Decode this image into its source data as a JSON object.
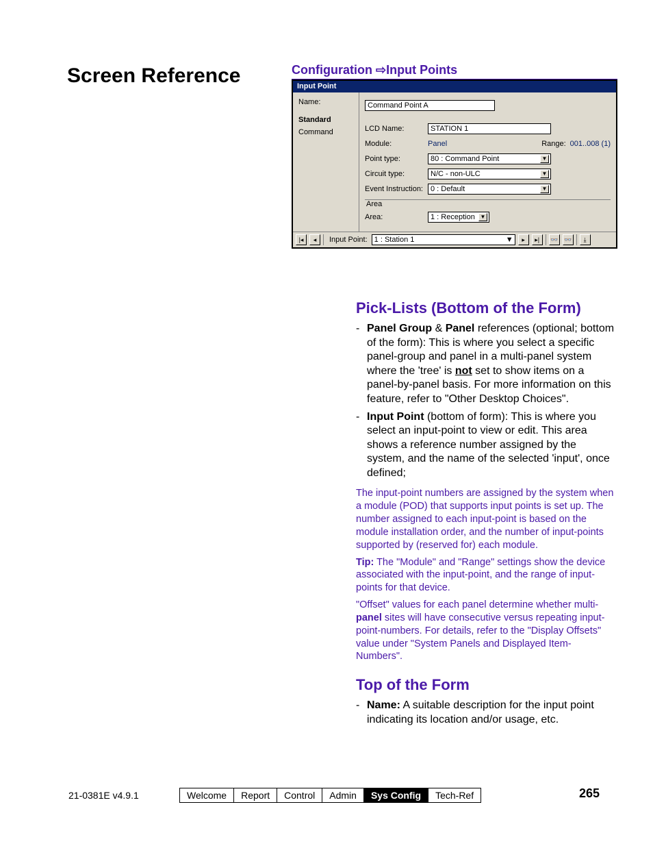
{
  "section_title": "Screen Reference",
  "breadcrumb": {
    "a": "Configuration",
    "sep": "⇨",
    "b": "Input Points"
  },
  "win": {
    "title": "Input Point",
    "left": {
      "name_label": "Name:",
      "tab_standard": "Standard",
      "tab_command": "Command"
    },
    "form": {
      "name_value": "Command Point A",
      "lcd_label": "LCD Name:",
      "lcd_value": "STATION 1",
      "module_label": "Module:",
      "module_value": "Panel",
      "range_label": "Range:",
      "range_value": "001..008 (1)",
      "point_type_label": "Point type:",
      "point_type_value": "80 : Command Point",
      "circuit_type_label": "Circuit type:",
      "circuit_type_value": "N/C - non-ULC",
      "event_instr_label": "Event Instruction:",
      "event_instr_value": "0 : Default",
      "area_group": "Area",
      "area_label": "Area:",
      "area_value": "1 : Reception"
    },
    "nav": {
      "first": "▏◂",
      "prev": "◂",
      "label": "Input Point:",
      "value": "1 : Station 1",
      "next": "▸",
      "last": "▸▏",
      "binoc1": "🔍",
      "binoc2": "🔎",
      "save": "💾"
    }
  },
  "sec_picklists": {
    "heading": "Pick-Lists (Bottom of the Form)",
    "b1_lead": "Panel Group",
    "b1_amp": " & ",
    "b1_lead2": "Panel",
    "b1_rest": " references (optional; bottom of the form): This is where you select a specific panel-group and panel in a multi-panel system where the 'tree' is ",
    "b1_not": "not",
    "b1_rest2": " set to show items on a panel-by-panel basis.  For more information on this feature, refer to \"Other Desktop Choices\".",
    "b2_lead": "Input Point",
    "b2_rest": " (bottom of form): This is where you select an input-point to view or edit.  This area shows a reference number assigned by the system, and the name of the selected 'input', once defined;",
    "note1": "The input-point numbers are assigned by the system when a module (POD) that supports input points is set up.  The number assigned to each input-point is based on the module installation order, and the number of input-points supported by (reserved for) each module.",
    "note2a": "Tip:",
    "note2b": "  The \"Module\" and \"Range\" settings show the device associated with the input-point, and the range of input-points for that device.",
    "note3a": "\"Offset\" values for each panel determine whether multi-",
    "note3b": "panel",
    "note3c": " sites will have consecutive versus repeating input-point-numbers.  For details, refer to the \"Display Offsets\" value under \"System Panels and Displayed Item-Numbers\"."
  },
  "sec_top": {
    "heading": "Top of the Form",
    "b1_lead": "Name:",
    "b1_rest": " A suitable description for the input point indicating its location and/or usage, etc."
  },
  "footer": {
    "doc": "21-0381E v4.9.1",
    "tabs": [
      "Welcome",
      "Report",
      "Control",
      "Admin",
      "Sys Config",
      "Tech-Ref"
    ],
    "page": "265"
  }
}
